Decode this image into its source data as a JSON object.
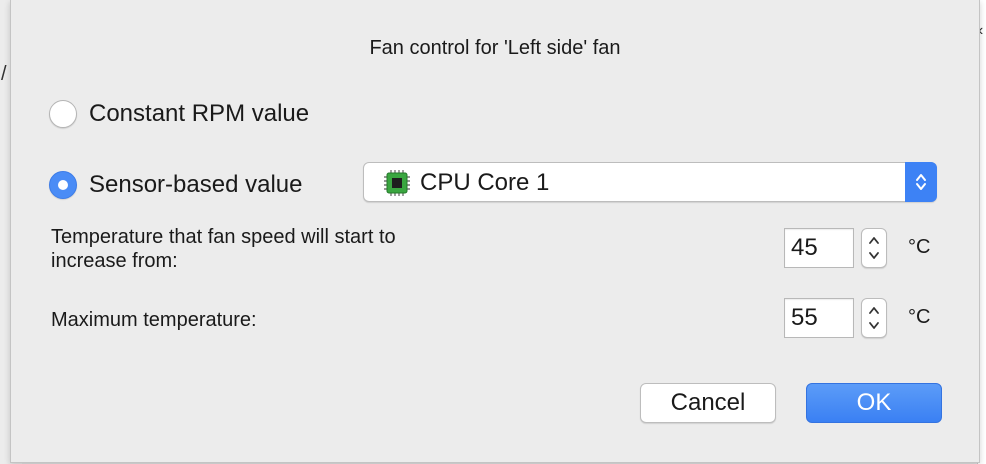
{
  "dialog": {
    "title": "Fan control for 'Left side' fan",
    "mode_options": [
      {
        "label": "Constant RPM value",
        "selected": false
      },
      {
        "label": "Sensor-based value",
        "selected": true
      }
    ],
    "sensor_select": {
      "value": "CPU Core 1",
      "icon": "cpu-chip-icon"
    },
    "start_temperature": {
      "label_line1": "Temperature that fan speed will start to",
      "label_line2": "increase from:",
      "value": "45",
      "unit": "°C"
    },
    "max_temperature": {
      "label": "Maximum temperature:",
      "value": "55",
      "unit": "°C"
    },
    "buttons": {
      "cancel": "Cancel",
      "ok": "OK"
    }
  },
  "colors": {
    "accent": "#3d82f5",
    "dialog_bg": "#ececec",
    "chip_green": "#3aa640"
  }
}
